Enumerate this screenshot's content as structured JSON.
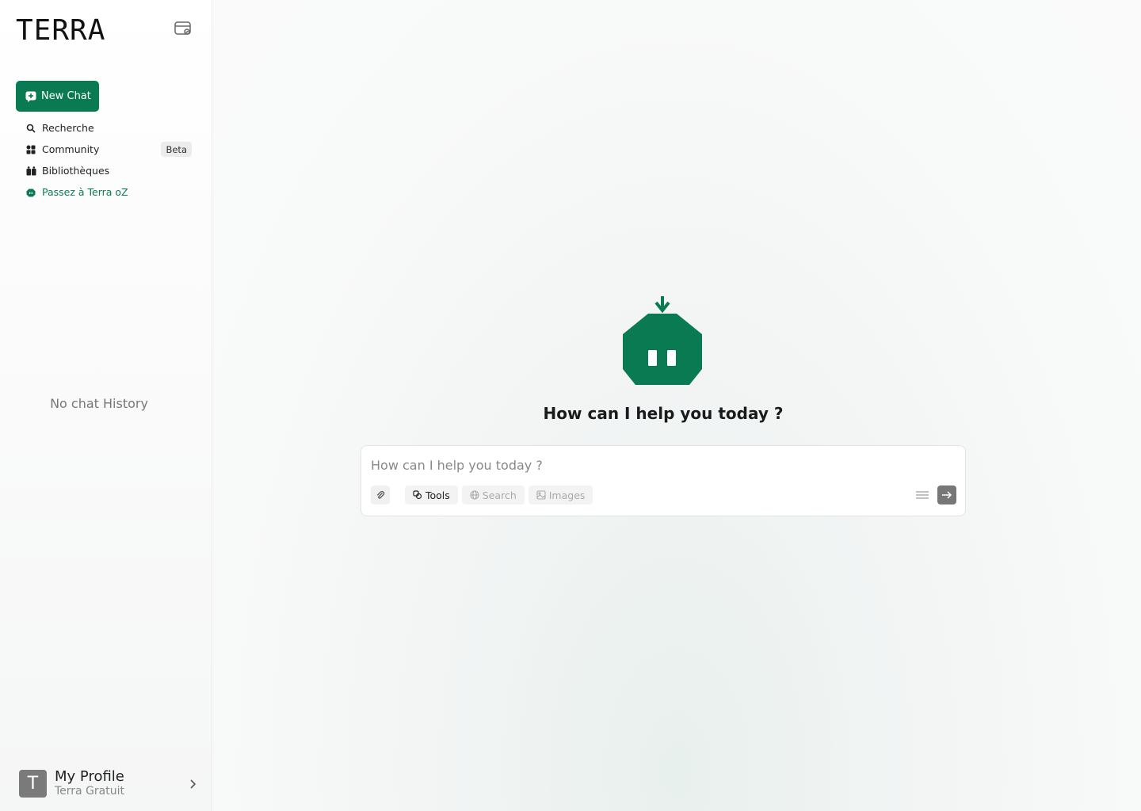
{
  "sidebar": {
    "logo": "TERRA",
    "new_chat_label": "New Chat",
    "items": [
      {
        "label": "Recherche",
        "icon": "search-icon"
      },
      {
        "label": "Community",
        "icon": "grid-icon",
        "badge": "Beta"
      },
      {
        "label": "Bibliothèques",
        "icon": "library-icon"
      },
      {
        "label": "Passez à Terra oZ",
        "icon": "robot-icon"
      }
    ],
    "empty_history": "No chat History",
    "profile": {
      "initial": "T",
      "name": "My Profile",
      "plan": "Terra Gratuit"
    }
  },
  "main": {
    "headline": "How can I help you today ?",
    "composer": {
      "placeholder": "How can I help you today ?",
      "value": "",
      "chips": [
        {
          "label": "Tools",
          "icon": "tools-icon",
          "active": true
        },
        {
          "label": "Search",
          "icon": "globe-icon",
          "active": false
        },
        {
          "label": "Images",
          "icon": "image-icon",
          "active": false
        }
      ]
    }
  },
  "colors": {
    "brand": "#0a7a52",
    "send_button": "#777777"
  }
}
